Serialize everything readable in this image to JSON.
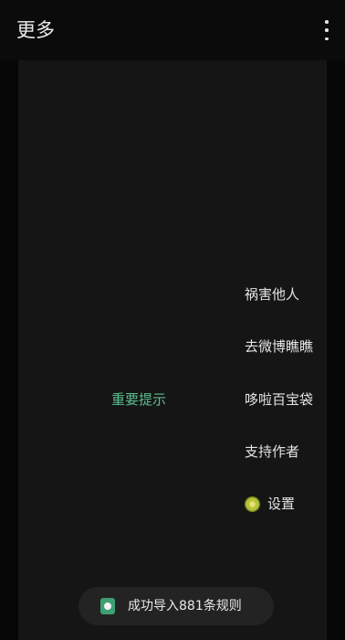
{
  "app_bar": {
    "title": "更多",
    "overflow_icon": "more-vert-icon"
  },
  "notice": {
    "label": "重要提示",
    "color": "#5dbd8f"
  },
  "menu": {
    "items": [
      {
        "label": "祸害他人"
      },
      {
        "label": "去微博瞧瞧"
      },
      {
        "label": "哆啦百宝袋"
      },
      {
        "label": "支持作者"
      }
    ],
    "settings": {
      "label": "设置",
      "icon": "kiwi-icon"
    }
  },
  "toast": {
    "text": "成功导入881条规则",
    "icon": "app-icon"
  }
}
